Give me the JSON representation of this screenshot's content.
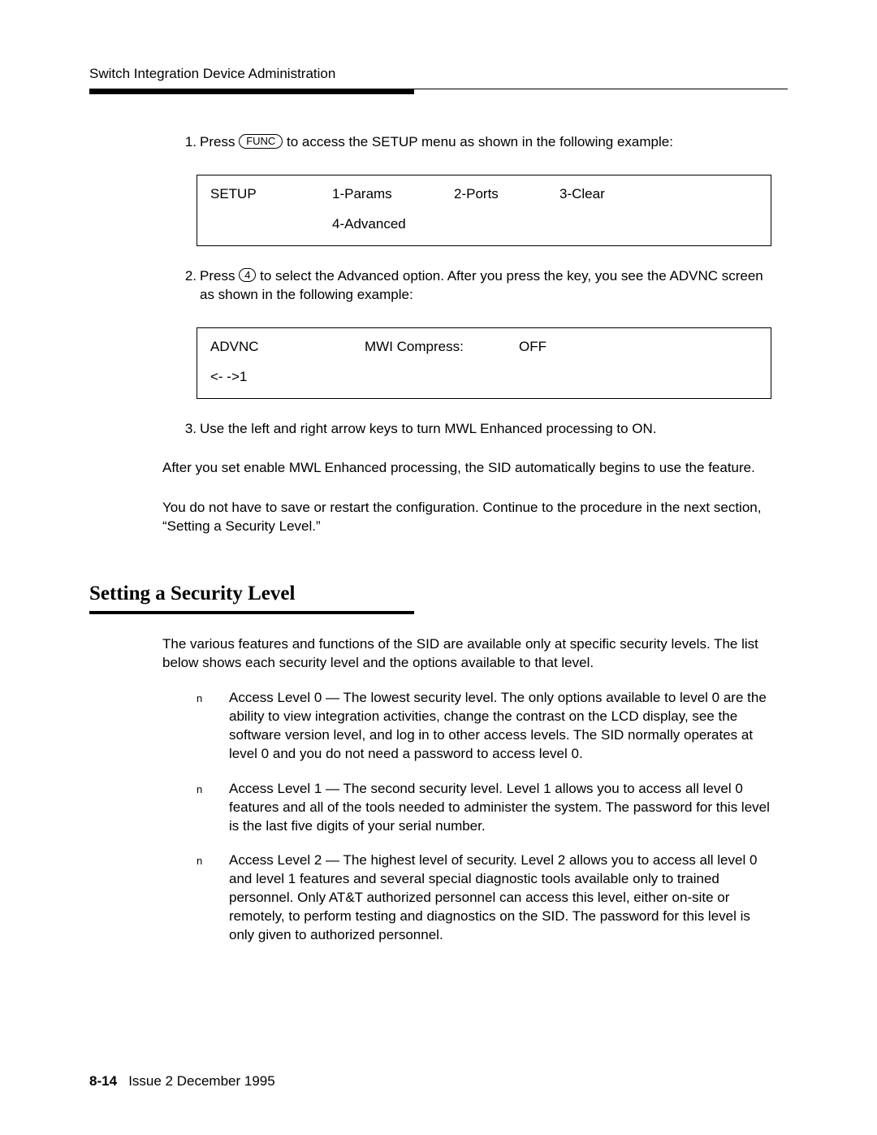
{
  "header": {
    "title": "Switch Integration Device Administration"
  },
  "steps": [
    {
      "num": "1.",
      "pre": "Press ",
      "key": "FUNC",
      "post": " to access the SETUP menu as shown in the following example:"
    },
    {
      "num": "2.",
      "pre": "Press ",
      "key": "4",
      "post": " to select the Advanced option. After you press the key, you see the ADVNC screen as shown in the following example:"
    },
    {
      "num": "3.",
      "text": "Use the left and right arrow keys to turn MWL Enhanced processing to ON."
    }
  ],
  "display1": {
    "r1c1": "SETUP",
    "r1c2": "1-Params",
    "r1c3": "2-Ports",
    "r1c4": "3-Clear",
    "r2c2": "4-Advanced"
  },
  "display2": {
    "r1c1": "ADVNC",
    "r1c2": "MWI Compress:",
    "r1c3": "OFF",
    "r2c1": "<-  ->1"
  },
  "paragraphs": {
    "p1": "After you set enable MWL Enhanced processing, the SID automatically begins to use the feature.",
    "p2": "You do not have to save or restart the configuration. Continue to the procedure in the next section, “Setting a Security Level.”"
  },
  "section": {
    "heading": "Setting a Security Level",
    "intro": "The various features and functions of the SID are available only at specific security levels. The list below shows each security level and the options available to that level.",
    "bullets": [
      "Access Level 0 — The lowest security level. The only options available to level 0 are the ability to view integration activities, change the contrast on the LCD display, see the software version level, and log in to other access levels. The SID normally operates at level 0 and you do not need a password to access level 0.",
      "Access Level 1 — The second security level. Level 1 allows you to access all level 0 features and all of the tools needed to administer the system. The password for this level is the last five digits of your serial number.",
      "Access Level 2 — The highest level of security. Level 2 allows you to access all level 0 and level 1 features and several special diagnostic tools available only to trained personnel. Only AT&T authorized personnel can access this level, either on-site or remotely, to perform testing and diagnostics on the SID. The password for this level is only given to authorized personnel."
    ]
  },
  "footer": {
    "page": "8-14",
    "issue": "Issue 2   December 1995"
  },
  "bullet_marker": "n"
}
